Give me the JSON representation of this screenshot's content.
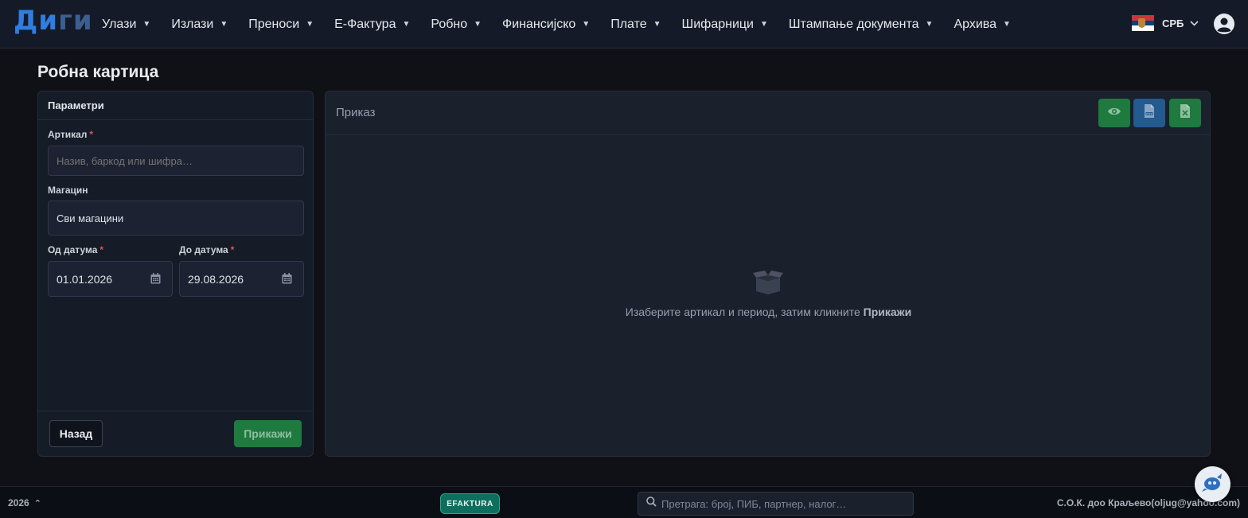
{
  "app": {
    "logo_part1": "Ди",
    "logo_part2": "ги"
  },
  "nav": {
    "items": [
      {
        "label": "Улази"
      },
      {
        "label": "Излази"
      },
      {
        "label": "Преноси"
      },
      {
        "label": "Е-Фактура"
      },
      {
        "label": "Робно"
      },
      {
        "label": "Финансијско"
      },
      {
        "label": "Плате"
      },
      {
        "label": "Шифарници"
      },
      {
        "label": "Штампање документа"
      },
      {
        "label": "Архива"
      }
    ],
    "caret_icon": "caret-down-icon",
    "language": "СРБ",
    "flag_colors": [
      "#c6363c",
      "#0c4076",
      "#ffffff"
    ],
    "user_icon": "user-circle-icon"
  },
  "page": {
    "title": "Робна картица"
  },
  "params": {
    "header": "Параметри",
    "article_label": "Артикал",
    "article_placeholder": "Назив, баркод или шифра…",
    "article_value": "",
    "warehouse_label": "Магацин",
    "warehouse_value": "Сви магацини",
    "from_label": "Од датума",
    "from_value": "01.01.2026",
    "to_label": "До датума",
    "to_value": "29.08.2026",
    "required_mark": "*",
    "back_button": "Назад",
    "show_button": "Прикажи"
  },
  "view": {
    "title": "Приказ",
    "empty_text": "Изаберите артикал и период, затим кликните ",
    "empty_text_bold": "Прикажи",
    "tools": [
      "eye-icon",
      "pdf-icon",
      "excel-icon"
    ]
  },
  "footer": {
    "year": "2026",
    "efaktura_badge": "EFAKTURA",
    "search_placeholder": "Претрага: број, ПИБ, партнер, налог…",
    "company": "С.О.К. доо Краљево(oljug@yahoo.com)"
  },
  "colors": {
    "accent": "#2f7de1",
    "success": "#1f7a40",
    "pdf": "#235a90",
    "required": "#e05260"
  }
}
